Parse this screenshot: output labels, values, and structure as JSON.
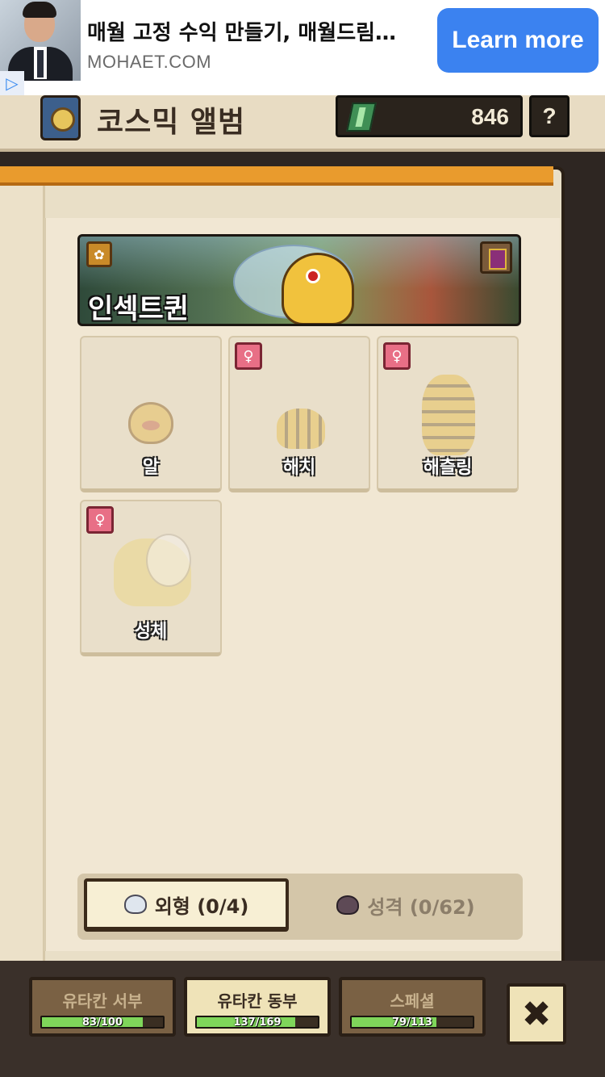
{
  "ad": {
    "title": "매월 고정 수익 만들기, 매월드림…",
    "domain": "MOHAET.COM",
    "cta": "Learn more",
    "badge_icon": "ad-choices-icon"
  },
  "header": {
    "title": "코스믹 앨범",
    "currency_value": "846",
    "currency_icon": "gem-icon",
    "help_label": "?"
  },
  "creature": {
    "name": "인섹트퀸",
    "badge_icon": "sprout-icon",
    "book_icon": "book-icon"
  },
  "stages": [
    {
      "label": "알",
      "gender_icon": ""
    },
    {
      "label": "해치",
      "gender_icon": "female-icon",
      "gender_symbol": "♀"
    },
    {
      "label": "해츨링",
      "gender_icon": "female-icon",
      "gender_symbol": "♀"
    },
    {
      "label": "성체",
      "gender_icon": "female-icon",
      "gender_symbol": "♀"
    }
  ],
  "toggle": {
    "appearance_label": "외형 (0/4)",
    "personality_label": "성격 (0/62)"
  },
  "tabs": [
    {
      "label": "유타칸 서부",
      "progress": "83/100",
      "fraction": 0.83
    },
    {
      "label": "유타칸 동부",
      "progress": "137/169",
      "fraction": 0.81
    },
    {
      "label": "스페셜",
      "progress": "79/113",
      "fraction": 0.7
    }
  ],
  "close_label": "✖"
}
